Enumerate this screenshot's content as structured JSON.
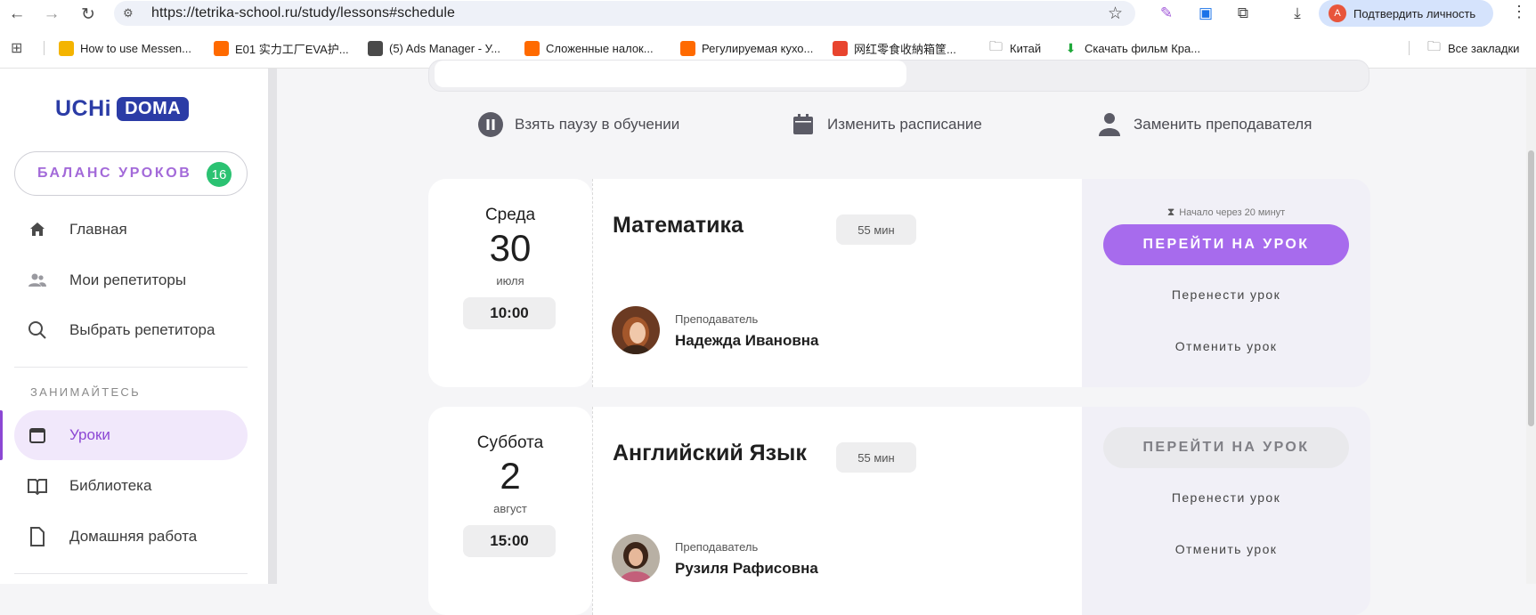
{
  "browser": {
    "url": "https://tetrika-school.ru/study/lessons#schedule",
    "verify_label": "Подтвердить личность",
    "bookmarks": [
      {
        "label": "How to use Messen...",
        "color": "#f4b400"
      },
      {
        "label": "E01 实力工厂EVA护...",
        "color": "#ff6a00"
      },
      {
        "label": "(5) Ads Manager - У...",
        "color": "#4a4a4a"
      },
      {
        "label": "Сложенные налок...",
        "color": "#ff6a00"
      },
      {
        "label": "Регулируемая кухо...",
        "color": "#ff6a00"
      },
      {
        "label": "网红零食收納箱筐...",
        "color": "#e8442e"
      },
      {
        "label": "Китай",
        "color": "folder"
      },
      {
        "label": "Скачать фильм Кра...",
        "color": "#1fa83a"
      }
    ],
    "all_bookmarks": "Все закладки"
  },
  "sidebar": {
    "logo": {
      "uchi": "UCHi",
      "doma": "DOMA"
    },
    "balance": {
      "label": "БАЛАНС УРОКОВ",
      "count": "16"
    },
    "items_top": [
      {
        "label": "Главная",
        "icon": "home-icon"
      },
      {
        "label": "Мои репетиторы",
        "icon": "users-icon"
      },
      {
        "label": "Выбрать репетитора",
        "icon": "search-icon"
      }
    ],
    "section_label": "ЗАНИМАЙТЕСЬ",
    "items_study": [
      {
        "label": "Уроки",
        "icon": "calendar-icon",
        "active": true
      },
      {
        "label": "Библиотека",
        "icon": "book-icon"
      },
      {
        "label": "Домашняя работа",
        "icon": "document-icon"
      }
    ]
  },
  "actions": {
    "pause": "Взять паузу в обучении",
    "schedule": "Изменить расписание",
    "replace": "Заменить преподавателя"
  },
  "lessons": [
    {
      "weekday": "Среда",
      "day": "30",
      "month": "июля",
      "time": "10:00",
      "subject": "Математика",
      "duration": "55 мин",
      "teacher_role": "Преподаватель",
      "teacher_name": "Надежда Ивановна",
      "starts_in": "Начало через 20 минут",
      "go_label": "ПЕРЕЙТИ НА УРОК",
      "go_enabled": true,
      "reschedule": "Перенести урок",
      "cancel": "Отменить урок"
    },
    {
      "weekday": "Суббота",
      "day": "2",
      "month": "август",
      "time": "15:00",
      "subject": "Английский Язык",
      "duration": "55 мин",
      "teacher_role": "Преподаватель",
      "teacher_name": "Рузиля Рафисовна",
      "go_label": "ПЕРЕЙТИ НА УРОК",
      "go_enabled": false,
      "reschedule": "Перенести урок",
      "cancel": "Отменить урок"
    }
  ],
  "colors": {
    "accent": "#a76bed",
    "brand": "#2b3ca6",
    "badge": "#2bc272"
  }
}
